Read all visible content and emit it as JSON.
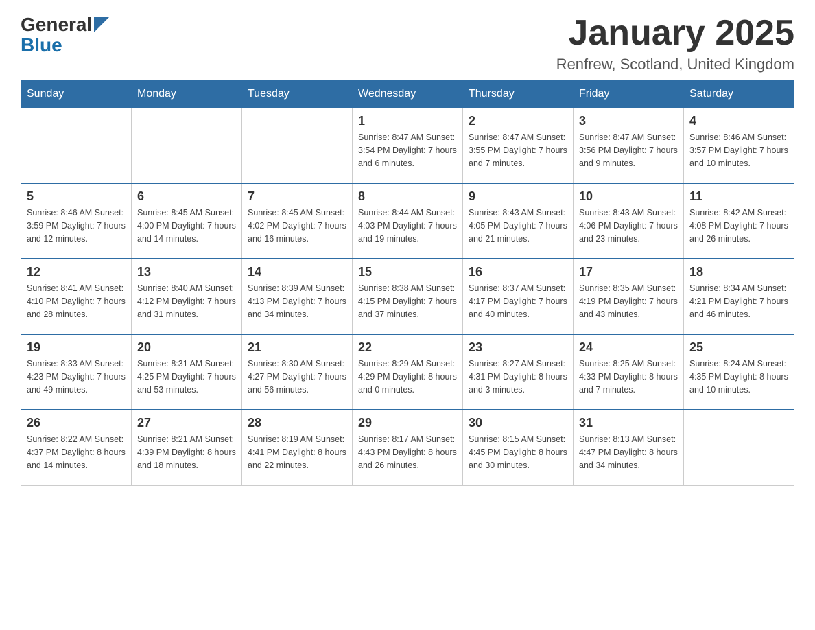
{
  "header": {
    "logo_general": "General",
    "logo_blue": "Blue",
    "title": "January 2025",
    "subtitle": "Renfrew, Scotland, United Kingdom"
  },
  "days_of_week": [
    "Sunday",
    "Monday",
    "Tuesday",
    "Wednesday",
    "Thursday",
    "Friday",
    "Saturday"
  ],
  "weeks": [
    [
      {
        "day": "",
        "info": ""
      },
      {
        "day": "",
        "info": ""
      },
      {
        "day": "",
        "info": ""
      },
      {
        "day": "1",
        "info": "Sunrise: 8:47 AM\nSunset: 3:54 PM\nDaylight: 7 hours and 6 minutes."
      },
      {
        "day": "2",
        "info": "Sunrise: 8:47 AM\nSunset: 3:55 PM\nDaylight: 7 hours and 7 minutes."
      },
      {
        "day": "3",
        "info": "Sunrise: 8:47 AM\nSunset: 3:56 PM\nDaylight: 7 hours and 9 minutes."
      },
      {
        "day": "4",
        "info": "Sunrise: 8:46 AM\nSunset: 3:57 PM\nDaylight: 7 hours and 10 minutes."
      }
    ],
    [
      {
        "day": "5",
        "info": "Sunrise: 8:46 AM\nSunset: 3:59 PM\nDaylight: 7 hours and 12 minutes."
      },
      {
        "day": "6",
        "info": "Sunrise: 8:45 AM\nSunset: 4:00 PM\nDaylight: 7 hours and 14 minutes."
      },
      {
        "day": "7",
        "info": "Sunrise: 8:45 AM\nSunset: 4:02 PM\nDaylight: 7 hours and 16 minutes."
      },
      {
        "day": "8",
        "info": "Sunrise: 8:44 AM\nSunset: 4:03 PM\nDaylight: 7 hours and 19 minutes."
      },
      {
        "day": "9",
        "info": "Sunrise: 8:43 AM\nSunset: 4:05 PM\nDaylight: 7 hours and 21 minutes."
      },
      {
        "day": "10",
        "info": "Sunrise: 8:43 AM\nSunset: 4:06 PM\nDaylight: 7 hours and 23 minutes."
      },
      {
        "day": "11",
        "info": "Sunrise: 8:42 AM\nSunset: 4:08 PM\nDaylight: 7 hours and 26 minutes."
      }
    ],
    [
      {
        "day": "12",
        "info": "Sunrise: 8:41 AM\nSunset: 4:10 PM\nDaylight: 7 hours and 28 minutes."
      },
      {
        "day": "13",
        "info": "Sunrise: 8:40 AM\nSunset: 4:12 PM\nDaylight: 7 hours and 31 minutes."
      },
      {
        "day": "14",
        "info": "Sunrise: 8:39 AM\nSunset: 4:13 PM\nDaylight: 7 hours and 34 minutes."
      },
      {
        "day": "15",
        "info": "Sunrise: 8:38 AM\nSunset: 4:15 PM\nDaylight: 7 hours and 37 minutes."
      },
      {
        "day": "16",
        "info": "Sunrise: 8:37 AM\nSunset: 4:17 PM\nDaylight: 7 hours and 40 minutes."
      },
      {
        "day": "17",
        "info": "Sunrise: 8:35 AM\nSunset: 4:19 PM\nDaylight: 7 hours and 43 minutes."
      },
      {
        "day": "18",
        "info": "Sunrise: 8:34 AM\nSunset: 4:21 PM\nDaylight: 7 hours and 46 minutes."
      }
    ],
    [
      {
        "day": "19",
        "info": "Sunrise: 8:33 AM\nSunset: 4:23 PM\nDaylight: 7 hours and 49 minutes."
      },
      {
        "day": "20",
        "info": "Sunrise: 8:31 AM\nSunset: 4:25 PM\nDaylight: 7 hours and 53 minutes."
      },
      {
        "day": "21",
        "info": "Sunrise: 8:30 AM\nSunset: 4:27 PM\nDaylight: 7 hours and 56 minutes."
      },
      {
        "day": "22",
        "info": "Sunrise: 8:29 AM\nSunset: 4:29 PM\nDaylight: 8 hours and 0 minutes."
      },
      {
        "day": "23",
        "info": "Sunrise: 8:27 AM\nSunset: 4:31 PM\nDaylight: 8 hours and 3 minutes."
      },
      {
        "day": "24",
        "info": "Sunrise: 8:25 AM\nSunset: 4:33 PM\nDaylight: 8 hours and 7 minutes."
      },
      {
        "day": "25",
        "info": "Sunrise: 8:24 AM\nSunset: 4:35 PM\nDaylight: 8 hours and 10 minutes."
      }
    ],
    [
      {
        "day": "26",
        "info": "Sunrise: 8:22 AM\nSunset: 4:37 PM\nDaylight: 8 hours and 14 minutes."
      },
      {
        "day": "27",
        "info": "Sunrise: 8:21 AM\nSunset: 4:39 PM\nDaylight: 8 hours and 18 minutes."
      },
      {
        "day": "28",
        "info": "Sunrise: 8:19 AM\nSunset: 4:41 PM\nDaylight: 8 hours and 22 minutes."
      },
      {
        "day": "29",
        "info": "Sunrise: 8:17 AM\nSunset: 4:43 PM\nDaylight: 8 hours and 26 minutes."
      },
      {
        "day": "30",
        "info": "Sunrise: 8:15 AM\nSunset: 4:45 PM\nDaylight: 8 hours and 30 minutes."
      },
      {
        "day": "31",
        "info": "Sunrise: 8:13 AM\nSunset: 4:47 PM\nDaylight: 8 hours and 34 minutes."
      },
      {
        "day": "",
        "info": ""
      }
    ]
  ]
}
